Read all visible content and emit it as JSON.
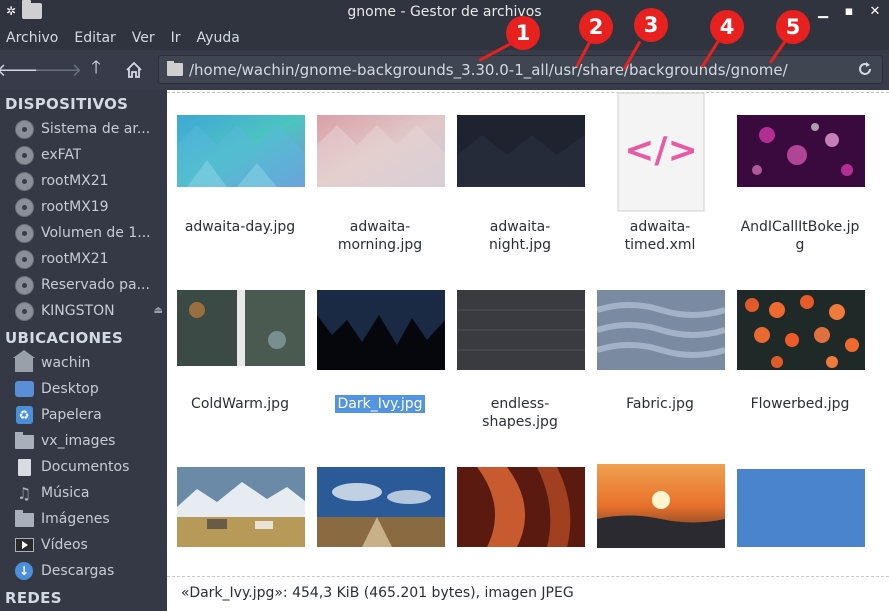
{
  "window": {
    "title": "gnome - Gestor de archivos",
    "controls": [
      "minimize",
      "maximize",
      "close"
    ]
  },
  "menu": [
    "Archivo",
    "Editar",
    "Ver",
    "Ir",
    "Ayuda"
  ],
  "toolbar": {
    "back_icon": "arrow-left-icon",
    "forward_icon": "arrow-right-icon",
    "up_icon": "arrow-up-icon",
    "home_icon": "home-icon",
    "path": "/home/wachin/gnome-backgrounds_3.30.0-1_all/usr/share/backgrounds/gnome/",
    "reload_icon": "reload-icon"
  },
  "annotations": [
    "1",
    "2",
    "3",
    "4",
    "5"
  ],
  "sidebar": {
    "devices_title": "DISPOSITIVOS",
    "devices": [
      "Sistema de ar...",
      "exFAT",
      "rootMX21",
      "rootMX19",
      "Volumen de 1...",
      "rootMX21",
      "Reservado pa...",
      "KINGSTON"
    ],
    "places_title": "UBICACIONES",
    "places": [
      {
        "label": "wachin",
        "icon": "home-icon"
      },
      {
        "label": "Desktop",
        "icon": "desktop-icon"
      },
      {
        "label": "Papelera",
        "icon": "trash-icon"
      },
      {
        "label": "vx_images",
        "icon": "folder-icon"
      },
      {
        "label": "Documentos",
        "icon": "document-icon"
      },
      {
        "label": "Música",
        "icon": "music-icon"
      },
      {
        "label": "Imágenes",
        "icon": "pictures-icon"
      },
      {
        "label": "Vídeos",
        "icon": "video-icon"
      },
      {
        "label": "Descargas",
        "icon": "download-icon"
      }
    ],
    "network_title": "REDES"
  },
  "files": [
    {
      "name": "adwaita-day.jpg",
      "lines": [
        "adwaita-day.jpg"
      ]
    },
    {
      "name": "adwaita-morning.jpg",
      "lines": [
        "adwaita-",
        "morning.jpg"
      ]
    },
    {
      "name": "adwaita-night.jpg",
      "lines": [
        "adwaita-",
        "night.jpg"
      ]
    },
    {
      "name": "adwaita-timed.xml",
      "lines": [
        "adwaita-",
        "timed.xml"
      ]
    },
    {
      "name": "AndICallItBoke.jpg",
      "lines": [
        "AndICallItBoke.jp",
        "g"
      ]
    },
    {
      "name": "ColdWarm.jpg",
      "lines": [
        "ColdWarm.jpg"
      ]
    },
    {
      "name": "Dark_Ivy.jpg",
      "lines": [
        "Dark_Ivy.jpg"
      ],
      "selected": true
    },
    {
      "name": "endless-shapes.jpg",
      "lines": [
        "endless-",
        "shapes.jpg"
      ]
    },
    {
      "name": "Fabric.jpg",
      "lines": [
        "Fabric.jpg"
      ]
    },
    {
      "name": "Flowerbed.jpg",
      "lines": [
        "Flowerbed.jpg"
      ]
    },
    {
      "name": "row3-1",
      "lines": []
    },
    {
      "name": "row3-2",
      "lines": []
    },
    {
      "name": "row3-3",
      "lines": []
    },
    {
      "name": "row3-4",
      "lines": []
    },
    {
      "name": "row3-5",
      "lines": []
    }
  ],
  "status": "«Dark_Ivy.jpg»: 454,3 KiB (465.201 bytes), imagen JPEG",
  "colors": {
    "titlebar": "#2f343f",
    "sidebar": "#353945",
    "selection": "#5294e2",
    "badge": "#e8211e"
  }
}
